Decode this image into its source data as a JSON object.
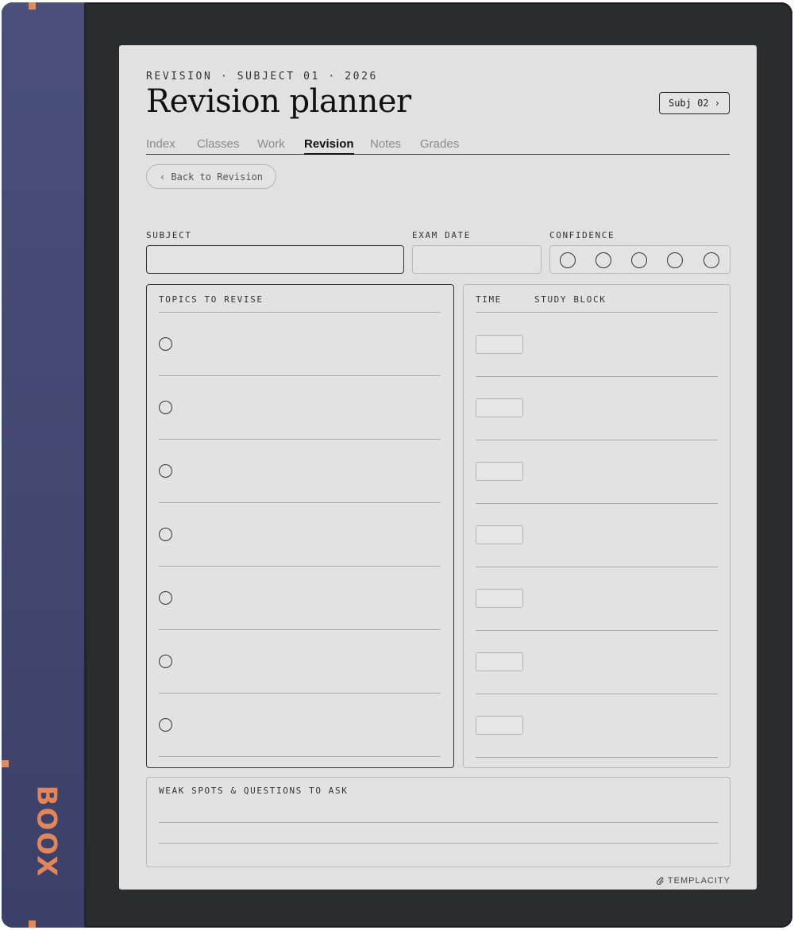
{
  "device": {
    "brand": "BOOX",
    "accent_color": "#e0865a",
    "spine_color": "#454a74"
  },
  "header": {
    "eyebrow": "REVISION · SUBJECT 01 · 2026",
    "title": "Revision planner",
    "next_subject_label": "Subj 02 ›"
  },
  "tabs": [
    {
      "label": "Index",
      "active": false
    },
    {
      "label": "Classes",
      "active": false
    },
    {
      "label": "Work",
      "active": false
    },
    {
      "label": "Revision",
      "active": true
    },
    {
      "label": "Notes",
      "active": false
    },
    {
      "label": "Grades",
      "active": false
    }
  ],
  "back_button_label": "‹ Back to Revision",
  "form": {
    "subject_label": "SUBJECT",
    "subject_value": "",
    "exam_date_label": "EXAM DATE",
    "exam_date_value": "",
    "confidence_label": "CONFIDENCE",
    "confidence_level": 0,
    "confidence_max": 5
  },
  "topics_panel": {
    "title": "TOPICS TO REVISE",
    "row_count": 7
  },
  "study_panel": {
    "time_header": "TIME",
    "block_header": "STUDY BLOCK",
    "row_count": 7
  },
  "weak_spots": {
    "title": "WEAK SPOTS & QUESTIONS TO ASK",
    "line_count": 2
  },
  "footer": {
    "logo_text": "TEMPLACITY",
    "logo_icon": "paperclip-icon"
  }
}
